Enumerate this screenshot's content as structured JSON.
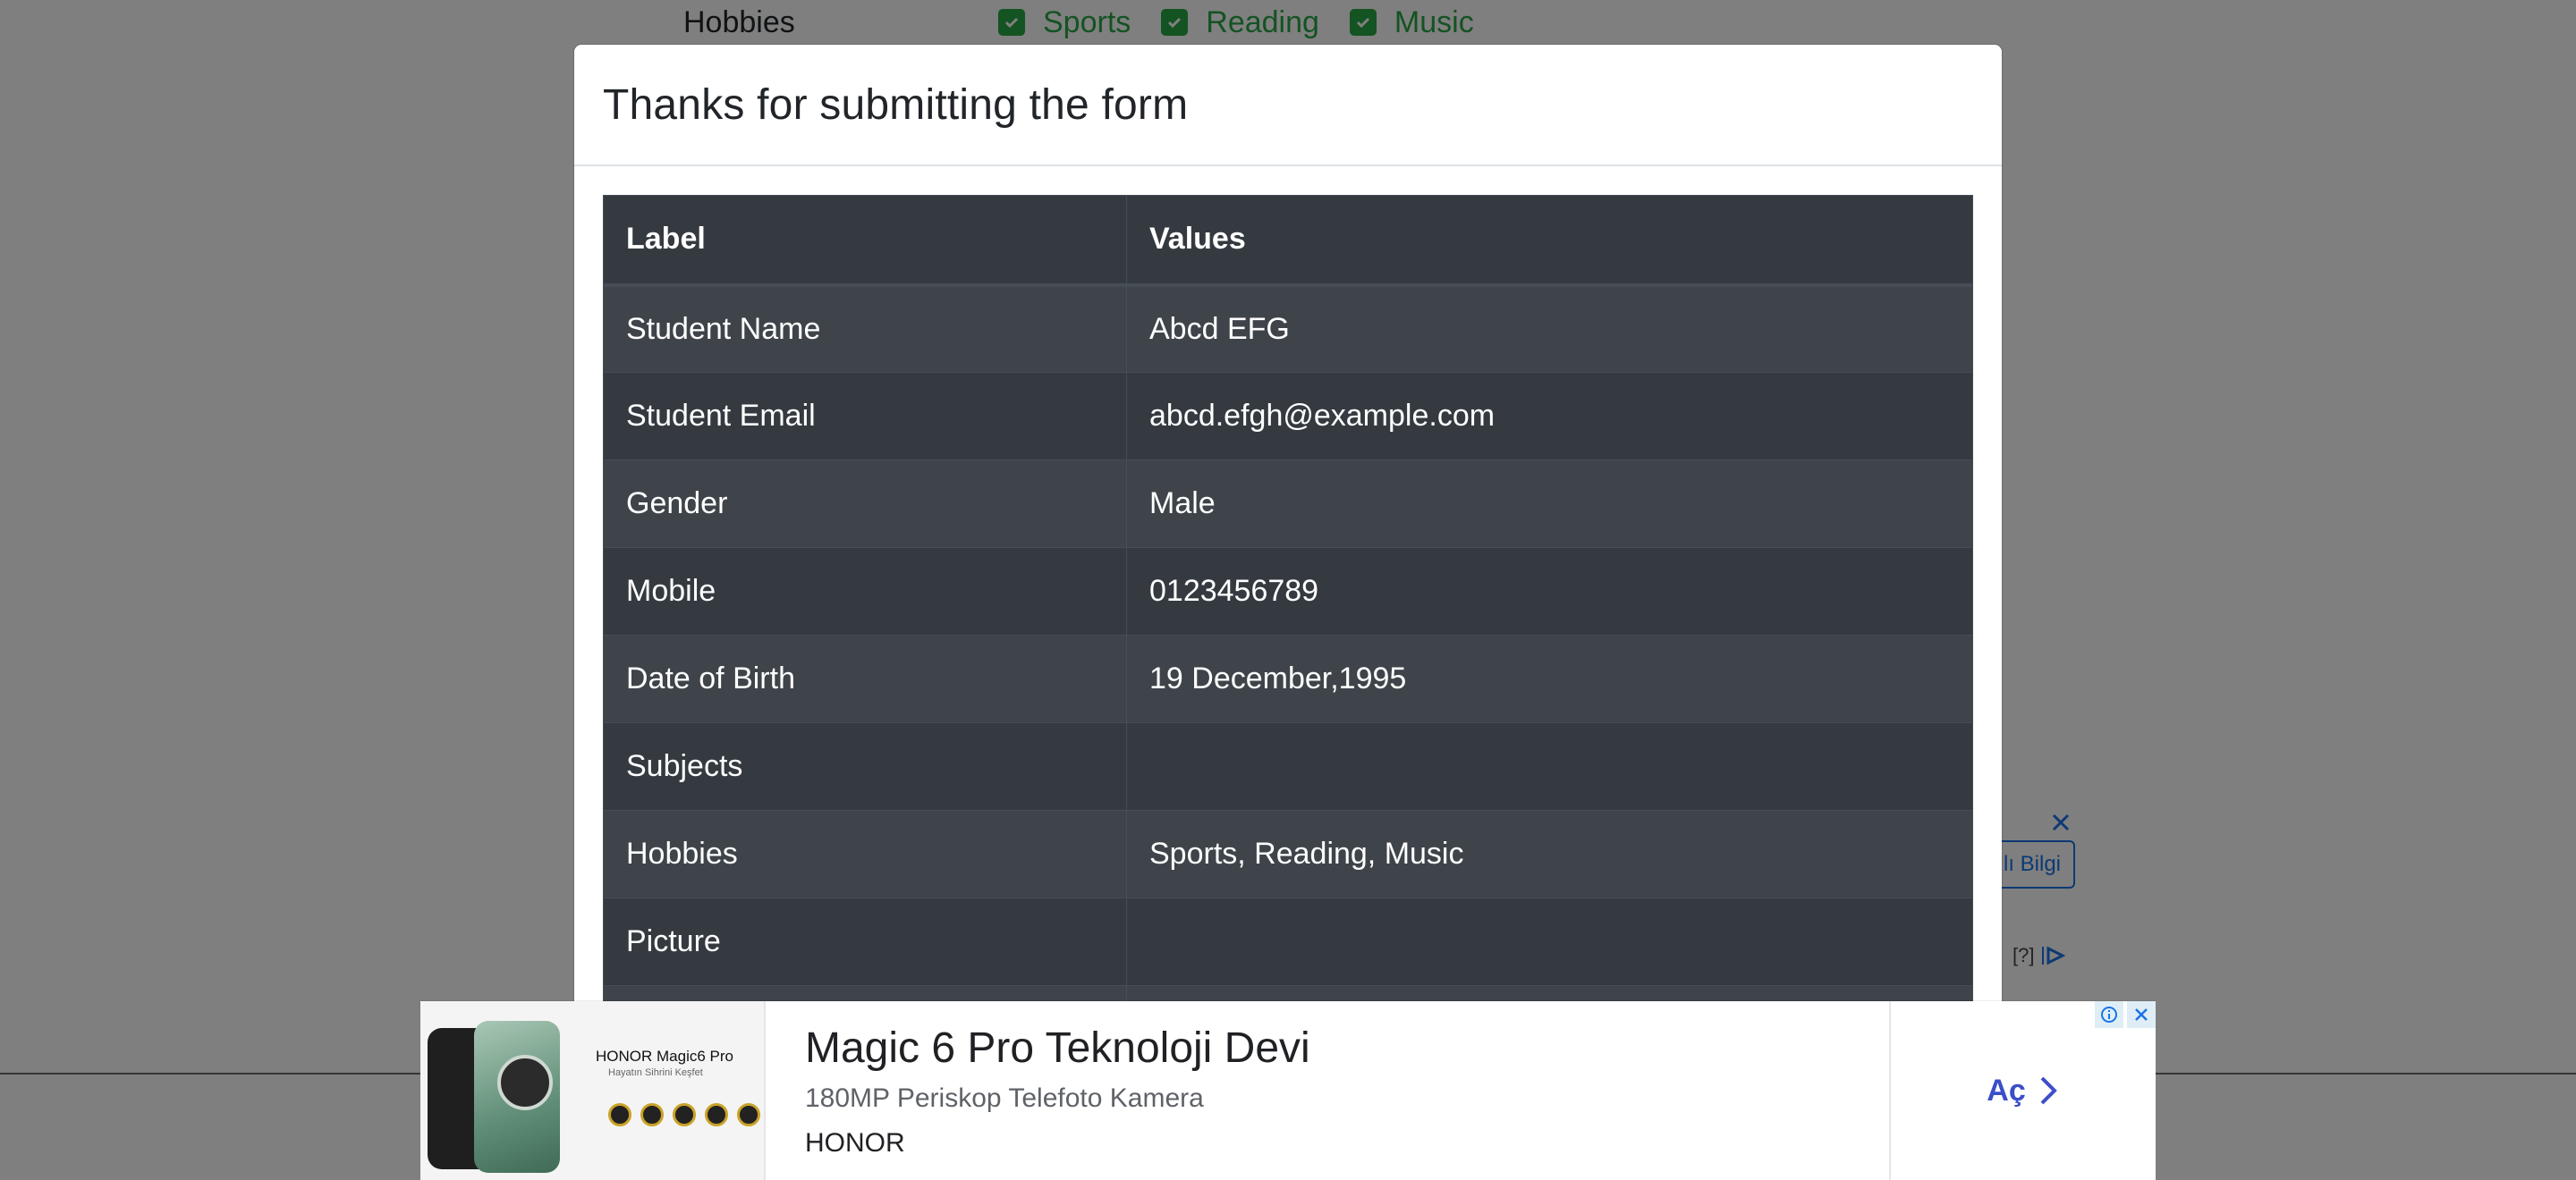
{
  "background": {
    "hobbies_label": "Hobbies",
    "hobby_options": [
      {
        "label": "Sports",
        "checked": true
      },
      {
        "label": "Reading",
        "checked": true
      },
      {
        "label": "Music",
        "checked": true
      }
    ],
    "side_ad_button": "ılı Bilgi",
    "side_ad_info": "[?]"
  },
  "modal": {
    "title": "Thanks for submitting the form",
    "table": {
      "headers": [
        "Label",
        "Values"
      ],
      "rows": [
        {
          "label": "Student Name",
          "value": "Abcd EFG"
        },
        {
          "label": "Student Email",
          "value": "abcd.efgh@example.com"
        },
        {
          "label": "Gender",
          "value": "Male"
        },
        {
          "label": "Mobile",
          "value": "0123456789"
        },
        {
          "label": "Date of Birth",
          "value": "19 December,1995"
        },
        {
          "label": "Subjects",
          "value": ""
        },
        {
          "label": "Hobbies",
          "value": "Sports, Reading, Music"
        },
        {
          "label": "Picture",
          "value": ""
        }
      ]
    }
  },
  "ad": {
    "product_brand": "HONOR Magic6 Pro",
    "product_tagline": "Hayatın Sihrini Keşfet",
    "headline": "Magic 6 Pro Teknoloji Devi",
    "description": "180MP Periskop Telefoto Kamera",
    "advertiser": "HONOR",
    "cta_label": "Aç"
  },
  "colors": {
    "table_dark": "#343a40",
    "table_stripe": "#3e444a",
    "checkbox_green": "#28a745",
    "ad_cta": "#3c4ec9"
  }
}
